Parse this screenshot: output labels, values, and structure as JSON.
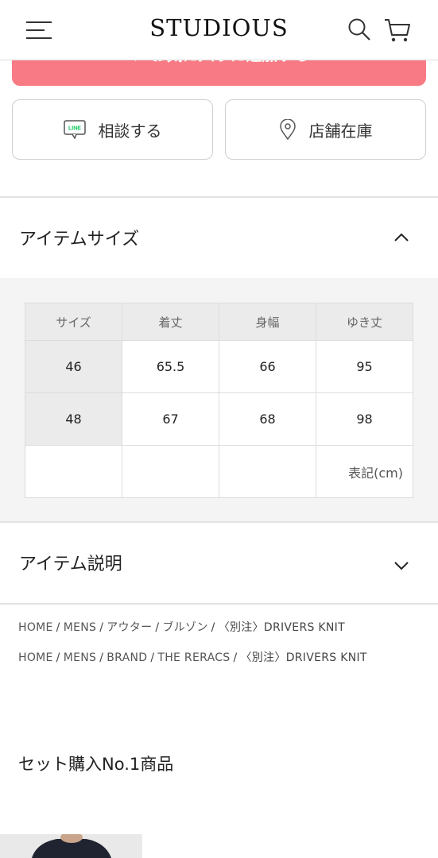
{
  "header": {
    "brand": "STUDIOUS"
  },
  "favorite": {
    "label": "お気に入りに追加する"
  },
  "actions": {
    "consult_label": "相談する",
    "line_badge": "LINE",
    "stock_label": "店舗在庫"
  },
  "item_size": {
    "heading": "アイテムサイズ",
    "columns": [
      "サイズ",
      "着丈",
      "身幅",
      "ゆき丈"
    ],
    "rows": [
      [
        "46",
        "65.5",
        "66",
        "95"
      ],
      [
        "48",
        "67",
        "68",
        "98"
      ]
    ],
    "unit_note": "表記(cm)"
  },
  "item_description": {
    "heading": "アイテム説明"
  },
  "breadcrumbs": [
    [
      "HOME",
      "MENS",
      "アウター",
      "ブルゾン",
      "〈別注〉DRIVERS KNIT"
    ],
    [
      "HOME",
      "MENS",
      "BRAND",
      "THE RERACS",
      "〈別注〉DRIVERS KNIT"
    ]
  ],
  "set_purchase": {
    "heading": "セット購入No.1商品"
  },
  "colors": {
    "favorite_bg": "#f87a84",
    "line_green": "#06c755",
    "table_head_bg": "#ebebeb",
    "section_bg": "#f5f4f4"
  }
}
